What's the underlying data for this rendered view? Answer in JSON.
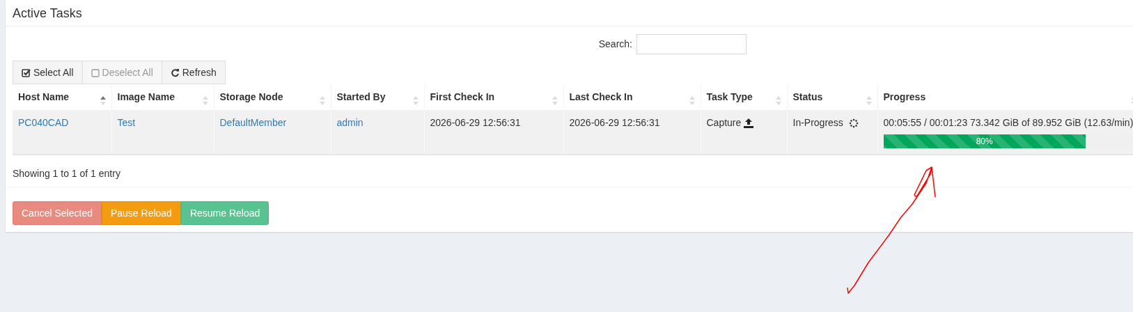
{
  "title": "Active Tasks",
  "search": {
    "label": "Search:"
  },
  "toolbar": [
    {
      "kind": "select",
      "label": "Select All",
      "disabled": false
    },
    {
      "kind": "deselect",
      "label": "Deselect All",
      "disabled": true
    },
    {
      "kind": "refresh",
      "label": "Refresh",
      "disabled": false
    }
  ],
  "table": {
    "columns": [
      {
        "label": "Host Name",
        "sorted": true
      },
      {
        "label": "Image Name",
        "sorted": false
      },
      {
        "label": "Storage Node",
        "sorted": false
      },
      {
        "label": "Started By",
        "sorted": false
      },
      {
        "label": "First Check In",
        "sorted": false
      },
      {
        "label": "Last Check In",
        "sorted": false
      },
      {
        "label": "Task Type",
        "sorted": false
      },
      {
        "label": "Status",
        "sorted": false
      },
      {
        "label": "Progress",
        "sorted": false
      }
    ],
    "rows": [
      {
        "host_name": "PC040CAD",
        "image_name": "Test",
        "storage_node": "DefaultMember",
        "started_by": "admin",
        "first_check_in": "2026-06-29 12:56:31",
        "last_check_in": "2026-06-29 12:56:31",
        "task_type": "Capture",
        "status": "In-Progress",
        "progress": {
          "text": "00:05:55 / 00:01:23 73.342 GiB of 89.952 GiB (12.63/min)",
          "level": 0.8,
          "label": "80%"
        }
      }
    ]
  },
  "info": "Showing 1 to 1 of 1 entry",
  "actions": [
    {
      "kind": "cancel",
      "label": "Cancel Selected"
    },
    {
      "kind": "pause",
      "label": "Pause Reload"
    },
    {
      "kind": "resume",
      "label": "Resume Reload"
    }
  ]
}
